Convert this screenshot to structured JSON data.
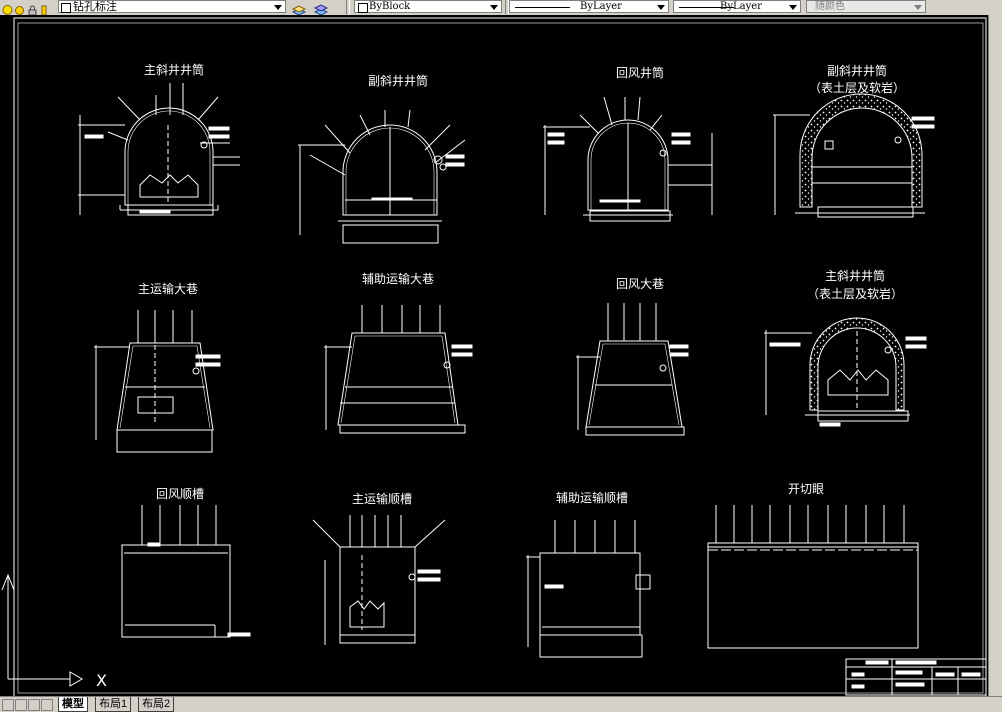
{
  "toolbar": {
    "layer_name": "钻孔标注",
    "color": "ByBlock",
    "linetype": "ByLayer",
    "lineweight": "ByLayer",
    "plot_style": "随颜色"
  },
  "drawings": {
    "d1": "主斜井井筒",
    "d2": "副斜井井筒",
    "d3": "回风井筒",
    "d4a": "副斜井井筒",
    "d4b": "（表土层及软岩）",
    "d5": "主运输大巷",
    "d6": "辅助运输大巷",
    "d7": "回风大巷",
    "d8a": "主斜井井筒",
    "d8b": "（表土层及软岩）",
    "d9": "回风顺槽",
    "d10": "主运输顺槽",
    "d11": "辅助运输顺槽",
    "d12": "开切眼"
  },
  "ucs": {
    "x_label": "X"
  },
  "tabs": {
    "model": "模型",
    "layout1": "布局1",
    "layout2": "布局2"
  }
}
